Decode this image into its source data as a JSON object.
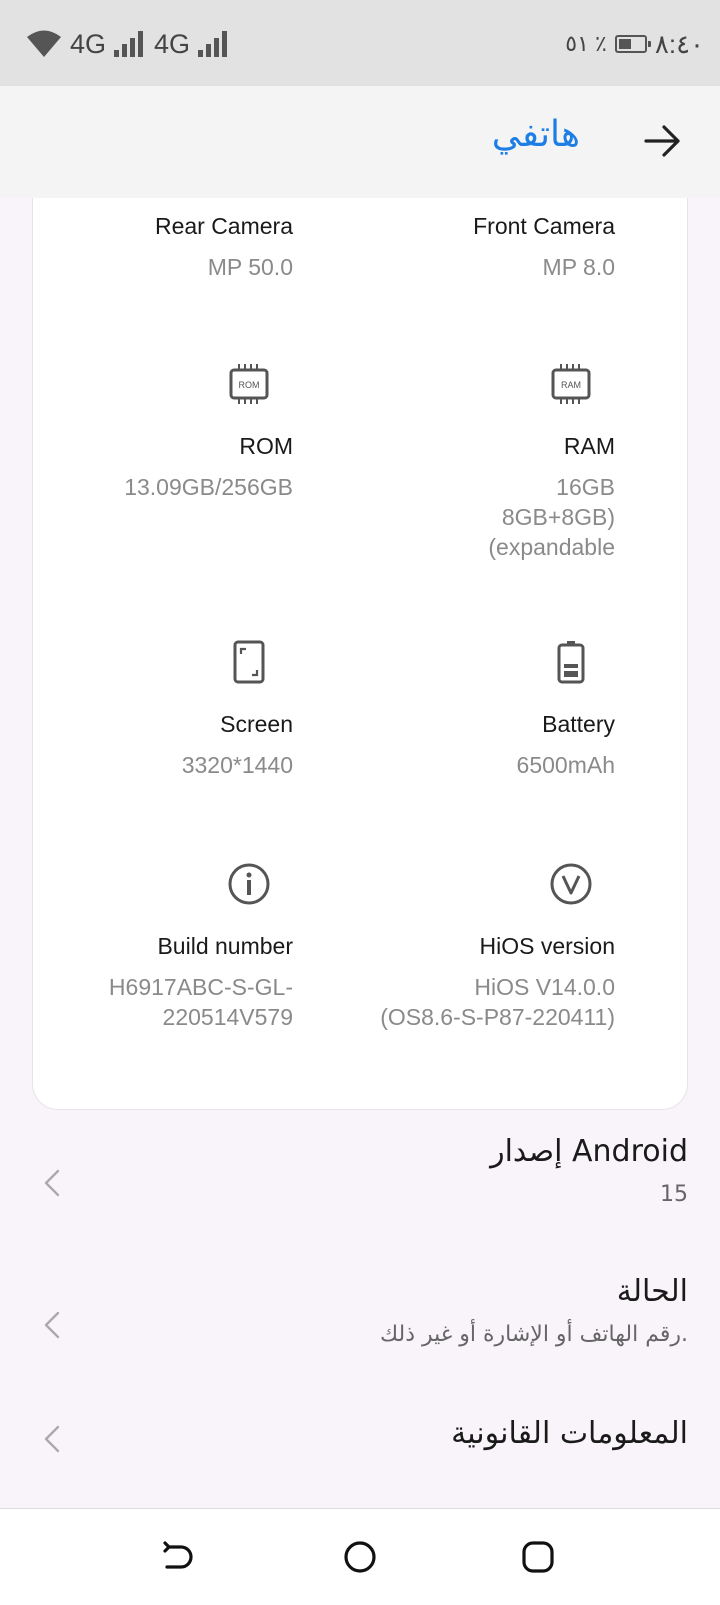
{
  "status_bar": {
    "network_1": "4G",
    "network_2": "4G",
    "battery_percent": "٥١ ٪",
    "battery_level": 0.51,
    "time": "٨:٤٠"
  },
  "app_bar": {
    "title": "هاتفي"
  },
  "specs": {
    "rear_camera": {
      "label": "Rear Camera",
      "value": "MP 50.0"
    },
    "front_camera": {
      "label": "Front Camera",
      "value": "MP 8.0"
    },
    "rom": {
      "label": "ROM",
      "value": "13.09GB/256GB",
      "icon_text": "ROM"
    },
    "ram": {
      "label": "RAM",
      "value": "16GB\n8GB+8GB)\n(expandable",
      "icon_text": "RAM"
    },
    "screen": {
      "label": "Screen",
      "value": "3320*1440"
    },
    "battery": {
      "label": "Battery",
      "value": "6500mAh"
    },
    "build_number": {
      "label": "Build number",
      "value": "H6917ABC-S-GL-\n220514V579"
    },
    "hios_version": {
      "label": "HiOS version",
      "value": "HiOS V14.0.0\n(OS8.6-S-P87-220411)"
    }
  },
  "settings": [
    {
      "title": "إصدار Android",
      "subtitle": "15"
    },
    {
      "title": "الحالة",
      "subtitle": "رقم الهاتف أو الإشارة أو غير ذلك."
    },
    {
      "title": "المعلومات القانونية"
    }
  ],
  "colors": {
    "accent": "#1d7fe6",
    "background": "#f9f4f9",
    "card": "#ffffff"
  }
}
